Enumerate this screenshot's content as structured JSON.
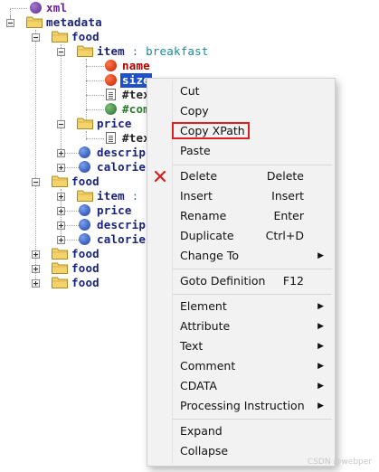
{
  "tree": {
    "nodes": [
      {
        "name": "xml",
        "type": "pi",
        "icon": "circle-purple-icon",
        "expanded": null
      },
      {
        "name": "metadata",
        "type": "element",
        "icon": "folder-icon",
        "expanded": true
      },
      {
        "name": "food",
        "type": "element",
        "icon": "folder-icon",
        "expanded": true
      },
      {
        "name": "item",
        "suffix": " : breakfast",
        "type": "element",
        "icon": "folder-icon",
        "expanded": true
      },
      {
        "name": "name",
        "type": "attribute",
        "icon": "circle-red-icon",
        "expanded": null
      },
      {
        "name": "size",
        "type": "attribute",
        "icon": "circle-red-icon",
        "expanded": null,
        "selected": true
      },
      {
        "name": "#tex",
        "type": "text",
        "icon": "text-doc-icon",
        "expanded": null
      },
      {
        "name": "#com",
        "type": "comment",
        "icon": "circle-green-icon",
        "expanded": null
      },
      {
        "name": "price",
        "type": "element",
        "icon": "folder-icon",
        "expanded": true
      },
      {
        "name": "#tex",
        "type": "text",
        "icon": "text-doc-icon",
        "expanded": null
      },
      {
        "name": "descrip",
        "type": "element",
        "icon": "circle-blue-icon",
        "expanded": false
      },
      {
        "name": "calorie",
        "type": "element",
        "icon": "circle-blue-icon",
        "expanded": false
      },
      {
        "name": "food",
        "type": "element",
        "icon": "folder-icon",
        "expanded": true
      },
      {
        "name": "item",
        "suffix": " :",
        "type": "element",
        "icon": "folder-icon",
        "expanded": false
      },
      {
        "name": "price",
        "type": "element",
        "icon": "circle-blue-icon",
        "expanded": false
      },
      {
        "name": "descrip",
        "type": "element",
        "icon": "circle-blue-icon",
        "expanded": false
      },
      {
        "name": "calorie",
        "type": "element",
        "icon": "circle-blue-icon",
        "expanded": false
      },
      {
        "name": "food",
        "type": "element",
        "icon": "folder-icon",
        "expanded": false
      },
      {
        "name": "food",
        "type": "element",
        "icon": "folder-icon",
        "expanded": false
      },
      {
        "name": "food",
        "type": "element",
        "icon": "folder-icon",
        "expanded": false
      }
    ]
  },
  "context_menu": {
    "items": [
      {
        "label": "Cut",
        "shortcut": "",
        "submenu": false
      },
      {
        "label": "Copy",
        "shortcut": "",
        "submenu": false
      },
      {
        "label": "Copy XPath",
        "shortcut": "",
        "submenu": false,
        "highlighted": true
      },
      {
        "label": "Paste",
        "shortcut": "",
        "submenu": false
      },
      {
        "label": "Delete",
        "shortcut": "Delete",
        "submenu": false,
        "icon": "red-x-icon"
      },
      {
        "label": "Insert",
        "shortcut": "Insert",
        "submenu": false
      },
      {
        "label": "Rename",
        "shortcut": "Enter",
        "submenu": false
      },
      {
        "label": "Duplicate",
        "shortcut": "Ctrl+D",
        "submenu": false
      },
      {
        "label": "Change To",
        "shortcut": "",
        "submenu": true
      },
      {
        "label": "Goto Definition",
        "shortcut": "F12",
        "submenu": false
      },
      {
        "label": "Element",
        "shortcut": "",
        "submenu": true
      },
      {
        "label": "Attribute",
        "shortcut": "",
        "submenu": true
      },
      {
        "label": "Text",
        "shortcut": "",
        "submenu": true
      },
      {
        "label": "Comment",
        "shortcut": "",
        "submenu": true
      },
      {
        "label": "CDATA",
        "shortcut": "",
        "submenu": true
      },
      {
        "label": "Processing Instruction",
        "shortcut": "",
        "submenu": true
      },
      {
        "label": "Expand",
        "shortcut": "",
        "submenu": false
      },
      {
        "label": "Collapse",
        "shortcut": "",
        "submenu": false
      }
    ],
    "arrow_glyph": "▶",
    "highlight_color": "#e02020"
  },
  "watermark": "CSDN @webper",
  "colors": {
    "element_text": "#1a237e",
    "attribute_text": "#b00000",
    "selection": "#1e50c8",
    "type_suffix": "#1a8aa0"
  }
}
